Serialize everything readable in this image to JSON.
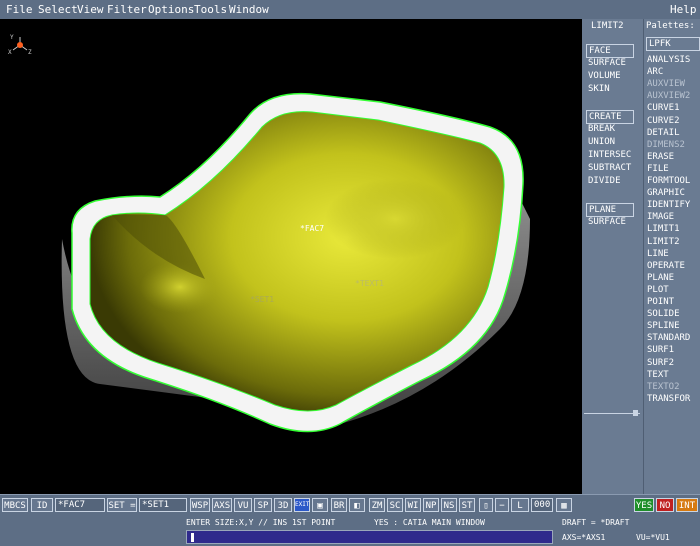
{
  "menu": [
    "File",
    "Select",
    "View",
    "Filter",
    "Options",
    "Tools",
    "Window"
  ],
  "help": "Help",
  "viewport": {
    "labels": [
      "*FAC7",
      "*SET1",
      "*TEXT1"
    ]
  },
  "panel": {
    "title": "LIMIT2",
    "groups": [
      [
        "FACE",
        "SURFACE",
        "VOLUME",
        "SKIN"
      ],
      [
        "CREATE",
        "BREAK",
        "UNION",
        "INTERSEC",
        "SUBTRACT",
        "DIVIDE"
      ],
      [
        "PLANE",
        "SURFACE"
      ]
    ]
  },
  "palettes": {
    "title": "Palettes:",
    "selected": "LPFK",
    "items": [
      "ANALYSIS",
      "ARC",
      "AUXVIEW",
      "AUXVIEW2",
      "CURVE1",
      "CURVE2",
      "DETAIL",
      "DIMENS2",
      "ERASE",
      "FILE",
      "FORMTOOL",
      "GRAPHIC",
      "IDENTIFY",
      "IMAGE",
      "LIMIT1",
      "LIMIT2",
      "LINE",
      "OPERATE",
      "PLANE",
      "PLOT",
      "POINT",
      "SOLIDE",
      "SPLINE",
      "STANDARD",
      "SURF1",
      "SURF2",
      "TEXT",
      "TEXTO2",
      "TRANSFOR"
    ],
    "dimmed": [
      "AUXVIEW",
      "AUXVIEW2",
      "DIMENS2",
      "TEXTO2"
    ]
  },
  "toolbar": {
    "mbcs": "MBCS",
    "id_label": "ID =",
    "id_value": "*FAC7",
    "set_label": "SET =",
    "set_value": "*SET1",
    "buttons": [
      "WSP",
      "AXS",
      "VU",
      "SP",
      "3D"
    ],
    "exit": "EXIT",
    "buttons2": [
      "BR",
      "ZM",
      "SC",
      "WI",
      "NP",
      "NS",
      "ST"
    ],
    "l_label": "L =",
    "l_value": "000",
    "yes": "YES",
    "no": "NO",
    "int": "INT"
  },
  "status": {
    "prompt": "ENTER SIZE:X,Y // INS 1ST POINT",
    "window": "YES : CATIA MAIN WINDOW",
    "draft": "DRAFT = *DRAFT",
    "axs": "AXS=*AXS1",
    "vu": "VU=*VU1"
  },
  "colors": {
    "background": "#5e6f86",
    "viewport": "#000000",
    "surface": "#c8c820",
    "edge": "#33ff33",
    "yes": "#1f8f2a",
    "no": "#c02020",
    "int": "#d67a10"
  }
}
